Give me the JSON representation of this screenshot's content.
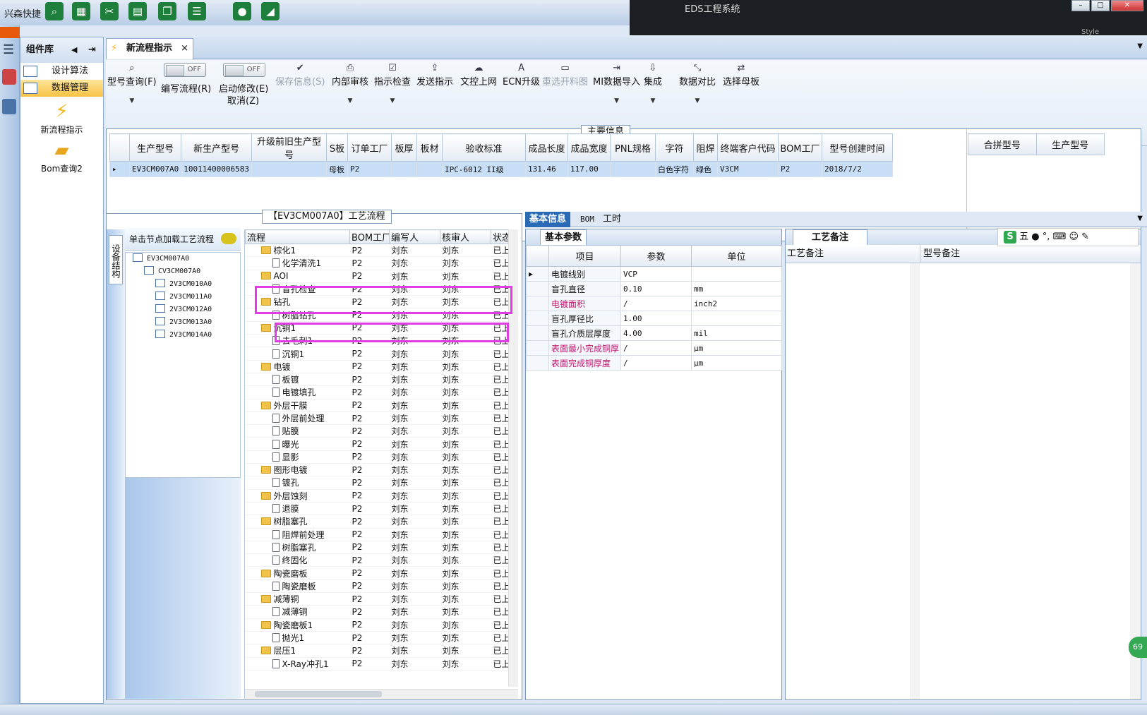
{
  "window": {
    "quick_access_label": "兴森快捷",
    "app_title": "EDS工程系统",
    "style_label": "Style"
  },
  "left_panel": {
    "title": "组件库",
    "items": [
      {
        "label": "设计算法"
      },
      {
        "label": "数据管理"
      }
    ],
    "big_items": [
      {
        "label": "新流程指示"
      },
      {
        "label": "Bom查询2"
      }
    ]
  },
  "doc_tab": {
    "label": "新流程指示"
  },
  "toolbar": {
    "model_query": "型号查询(F)",
    "edit_flow": "编写流程(R)",
    "edit_flow_toggle": "OFF",
    "start_modify": "启动修改(E)",
    "cancel": "取消(Z)",
    "start_modify_toggle": "OFF",
    "save_info": "保存信息(S)",
    "internal_review": "内部审核",
    "instruction_check": "指示检查",
    "send_instruction": "发送指示",
    "upload": "文控上网",
    "ecn_upgrade": "ECN升级",
    "reselect_drawing": "重选开料图",
    "mi_import": "MI数据导入",
    "integrate": "集成",
    "data_compare": "数据对比",
    "select_mother_board": "选择母板"
  },
  "main_info": {
    "title": "主要信息",
    "columns": [
      "生产型号",
      "新生产型号",
      "升级前旧生产型号",
      "S板",
      "订单工厂",
      "板厚",
      "板材",
      "验收标准",
      "成品长度",
      "成品宽度",
      "PNL规格",
      "字符",
      "阻焊",
      "终端客户代码",
      "BOM工厂",
      "型号创建时间"
    ],
    "row": [
      "EV3CM007A0",
      "10011400006583",
      "",
      "母板",
      "P2",
      "",
      "",
      "IPC-6012 II级",
      "131.46",
      "117.00",
      "",
      "白色字符",
      "绿色",
      "V3CM",
      "P2",
      "2018/7/2"
    ],
    "merge_columns": [
      "合拼型号",
      "生产型号"
    ]
  },
  "process": {
    "title": "【EV3CM007A0】工艺流程",
    "side_tab": "设备结构",
    "hint": "单击节点加载工艺流程",
    "tree": [
      {
        "label": "EV3CM007A0",
        "level": 0
      },
      {
        "label": "CV3CM007A0",
        "level": 1
      },
      {
        "label": "2V3CM010A0",
        "level": 2
      },
      {
        "label": "2V3CM011A0",
        "level": 2
      },
      {
        "label": "2V3CM012A0",
        "level": 2
      },
      {
        "label": "2V3CM013A0",
        "level": 2
      },
      {
        "label": "2V3CM014A0",
        "level": 2
      }
    ],
    "columns": [
      "流程",
      "BOM工厂",
      "编写人",
      "核审人",
      "状态"
    ],
    "rows": [
      {
        "name": "棕化1",
        "folder": true,
        "bom": "P2",
        "writer": "刘东",
        "reviewer": "刘东",
        "status": "已上"
      },
      {
        "name": "化学清洗1",
        "folder": false,
        "bom": "P2",
        "writer": "刘东",
        "reviewer": "刘东",
        "status": "已上"
      },
      {
        "name": "AOI",
        "folder": true,
        "bom": "P2",
        "writer": "刘东",
        "reviewer": "刘东",
        "status": "已上"
      },
      {
        "name": "盲孔检查",
        "folder": false,
        "bom": "P2",
        "writer": "刘东",
        "reviewer": "刘东",
        "status": "已上"
      },
      {
        "name": "钻孔",
        "folder": true,
        "bom": "P2",
        "writer": "刘东",
        "reviewer": "刘东",
        "status": "已上"
      },
      {
        "name": "树脂钻孔",
        "folder": false,
        "bom": "P2",
        "writer": "刘东",
        "reviewer": "刘东",
        "status": "已上"
      },
      {
        "name": "沉铜1",
        "folder": true,
        "bom": "P2",
        "writer": "刘东",
        "reviewer": "刘东",
        "status": "已上"
      },
      {
        "name": "去毛刺1",
        "folder": false,
        "bom": "P2",
        "writer": "刘东",
        "reviewer": "刘东",
        "status": "已上"
      },
      {
        "name": "沉铜1",
        "folder": false,
        "bom": "P2",
        "writer": "刘东",
        "reviewer": "刘东",
        "status": "已上"
      },
      {
        "name": "电镀",
        "folder": true,
        "bom": "P2",
        "writer": "刘东",
        "reviewer": "刘东",
        "status": "已上"
      },
      {
        "name": "板镀",
        "folder": false,
        "bom": "P2",
        "writer": "刘东",
        "reviewer": "刘东",
        "status": "已上"
      },
      {
        "name": "电镀填孔",
        "folder": false,
        "bom": "P2",
        "writer": "刘东",
        "reviewer": "刘东",
        "status": "已上"
      },
      {
        "name": "外层干膜",
        "folder": true,
        "bom": "P2",
        "writer": "刘东",
        "reviewer": "刘东",
        "status": "已上"
      },
      {
        "name": "外层前处理",
        "folder": false,
        "bom": "P2",
        "writer": "刘东",
        "reviewer": "刘东",
        "status": "已上"
      },
      {
        "name": "贴膜",
        "folder": false,
        "bom": "P2",
        "writer": "刘东",
        "reviewer": "刘东",
        "status": "已上"
      },
      {
        "name": "曝光",
        "folder": false,
        "bom": "P2",
        "writer": "刘东",
        "reviewer": "刘东",
        "status": "已上"
      },
      {
        "name": "显影",
        "folder": false,
        "bom": "P2",
        "writer": "刘东",
        "reviewer": "刘东",
        "status": "已上"
      },
      {
        "name": "图形电镀",
        "folder": true,
        "bom": "P2",
        "writer": "刘东",
        "reviewer": "刘东",
        "status": "已上"
      },
      {
        "name": "镀孔",
        "folder": false,
        "bom": "P2",
        "writer": "刘东",
        "reviewer": "刘东",
        "status": "已上"
      },
      {
        "name": "外层蚀刻",
        "folder": true,
        "bom": "P2",
        "writer": "刘东",
        "reviewer": "刘东",
        "status": "已上"
      },
      {
        "name": "退膜",
        "folder": false,
        "bom": "P2",
        "writer": "刘东",
        "reviewer": "刘东",
        "status": "已上"
      },
      {
        "name": "树脂塞孔",
        "folder": true,
        "bom": "P2",
        "writer": "刘东",
        "reviewer": "刘东",
        "status": "已上"
      },
      {
        "name": "阻焊前处理",
        "folder": false,
        "bom": "P2",
        "writer": "刘东",
        "reviewer": "刘东",
        "status": "已上"
      },
      {
        "name": "树脂塞孔",
        "folder": false,
        "bom": "P2",
        "writer": "刘东",
        "reviewer": "刘东",
        "status": "已上"
      },
      {
        "name": "终固化",
        "folder": false,
        "bom": "P2",
        "writer": "刘东",
        "reviewer": "刘东",
        "status": "已上"
      },
      {
        "name": "陶瓷磨板",
        "folder": true,
        "bom": "P2",
        "writer": "刘东",
        "reviewer": "刘东",
        "status": "已上"
      },
      {
        "name": "陶瓷磨板",
        "folder": false,
        "bom": "P2",
        "writer": "刘东",
        "reviewer": "刘东",
        "status": "已上"
      },
      {
        "name": "减薄铜",
        "folder": true,
        "bom": "P2",
        "writer": "刘东",
        "reviewer": "刘东",
        "status": "已上"
      },
      {
        "name": "减薄铜",
        "folder": false,
        "bom": "P2",
        "writer": "刘东",
        "reviewer": "刘东",
        "status": "已上"
      },
      {
        "name": "陶瓷磨板1",
        "folder": true,
        "bom": "P2",
        "writer": "刘东",
        "reviewer": "刘东",
        "status": "已上"
      },
      {
        "name": "抛光1",
        "folder": false,
        "bom": "P2",
        "writer": "刘东",
        "reviewer": "刘东",
        "status": "已上"
      },
      {
        "name": "层压1",
        "folder": true,
        "bom": "P2",
        "writer": "刘东",
        "reviewer": "刘东",
        "status": "已上"
      },
      {
        "name": "X-Ray冲孔1",
        "folder": false,
        "bom": "P2",
        "writer": "刘东",
        "reviewer": "刘东",
        "status": "已上"
      }
    ]
  },
  "detail_tabs": [
    "基本信息",
    "BOM",
    "工时"
  ],
  "basic_params": {
    "tab": "基本参数",
    "columns": [
      "项目",
      "参数",
      "单位"
    ],
    "rows": [
      {
        "item": "电镀线别",
        "value": "VCP",
        "unit": "",
        "pink": false
      },
      {
        "item": "盲孔直径",
        "value": "0.10",
        "unit": "mm",
        "pink": false
      },
      {
        "item": "电镀面积",
        "value": "/",
        "unit": "inch2",
        "pink": true
      },
      {
        "item": "盲孔厚径比",
        "value": "1.00",
        "unit": "",
        "pink": false
      },
      {
        "item": "盲孔介质层厚度",
        "value": "4.00",
        "unit": "mil",
        "pink": false
      },
      {
        "item": "表面最小完成铜厚",
        "value": "/",
        "unit": "μm",
        "pink": true
      },
      {
        "item": "表面完成铜厚度",
        "value": "/",
        "unit": "μm",
        "pink": true
      }
    ]
  },
  "craft_notes": {
    "tab": "工艺备注",
    "col1": "工艺备注",
    "col2": "型号备注",
    "ime_label": "五"
  },
  "status": {
    "right_badge": "69"
  }
}
